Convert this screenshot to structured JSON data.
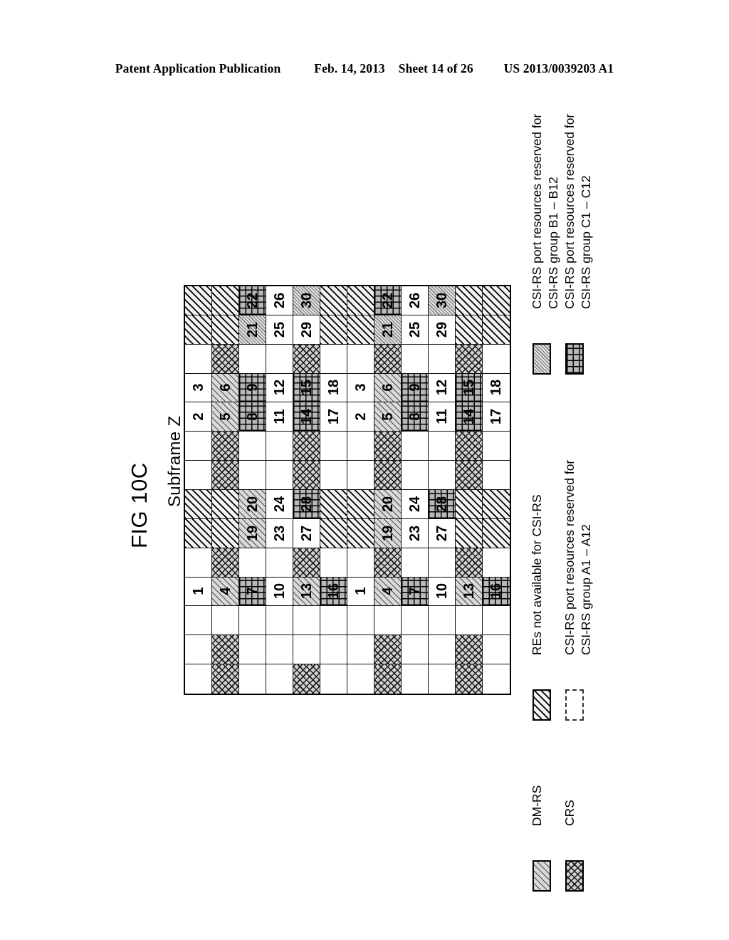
{
  "header": {
    "publication": "Patent Application Publication",
    "date": "Feb. 14, 2013",
    "sheet": "Sheet 14 of 26",
    "doc_number": "US 2013/0039203 A1"
  },
  "figure": {
    "title": "FIG 10C",
    "subtitle": "Subframe Z"
  },
  "legend": {
    "top_right": [
      {
        "swatch": "groupb-swatch",
        "line1": "CSI-RS port resources reserved for",
        "line2": "CSI-RS group B1 – B12"
      },
      {
        "swatch": "groupc-swatch",
        "line1": "CSI-RS port resources reserved for",
        "line2": "CSI-RS group C1 – C12"
      }
    ],
    "middle_right": [
      {
        "swatch": "na-swatch",
        "line1": "REs not available for CSI-RS",
        "line2": ""
      },
      {
        "swatch": "groupa-swatch",
        "line1": "CSI-RS port resources reserved for",
        "line2": "CSI-RS group A1 – A12"
      }
    ],
    "bottom_right": [
      {
        "swatch": "dmrs-swatch",
        "line1": "DM-RS",
        "line2": ""
      },
      {
        "swatch": "crs-swatch",
        "line1": "CRS",
        "line2": ""
      }
    ]
  },
  "grid": {
    "columns": 12,
    "rows": 14,
    "cell_types": {
      "white": "p-white",
      "na": "p-na",
      "dmrs": "p-dmrs",
      "crs": "p-crs",
      "groupb": "p-groupb",
      "groupc": "p-groupc"
    },
    "cells": [
      [
        {
          "t": "na"
        },
        {
          "t": "na"
        },
        {
          "t": "groupc",
          "n": "22"
        },
        {
          "t": "white",
          "n": "26"
        },
        {
          "t": "groupb",
          "n": "30"
        },
        {
          "t": "na"
        },
        {
          "t": "na"
        },
        {
          "t": "groupc",
          "n": "22"
        },
        {
          "t": "white",
          "n": "26"
        },
        {
          "t": "groupb",
          "n": "30"
        },
        {
          "t": "na"
        },
        {
          "t": "na"
        }
      ],
      [
        {
          "t": "na"
        },
        {
          "t": "na"
        },
        {
          "t": "groupb",
          "n": "21"
        },
        {
          "t": "white",
          "n": "25"
        },
        {
          "t": "white",
          "n": "29"
        },
        {
          "t": "na"
        },
        {
          "t": "na"
        },
        {
          "t": "groupb",
          "n": "21"
        },
        {
          "t": "white",
          "n": "25"
        },
        {
          "t": "white",
          "n": "29"
        },
        {
          "t": "na"
        },
        {
          "t": "na"
        }
      ],
      [
        {
          "t": "white"
        },
        {
          "t": "crs"
        },
        {
          "t": "white"
        },
        {
          "t": "white"
        },
        {
          "t": "crs"
        },
        {
          "t": "white"
        },
        {
          "t": "white"
        },
        {
          "t": "crs"
        },
        {
          "t": "white"
        },
        {
          "t": "white"
        },
        {
          "t": "crs"
        },
        {
          "t": "white"
        }
      ],
      [
        {
          "t": "white",
          "n": "3"
        },
        {
          "t": "dmrs",
          "n": "6"
        },
        {
          "t": "groupc",
          "n": "9"
        },
        {
          "t": "white",
          "n": "12"
        },
        {
          "t": "groupc",
          "n": "15"
        },
        {
          "t": "white",
          "n": "18"
        },
        {
          "t": "white",
          "n": "3"
        },
        {
          "t": "dmrs",
          "n": "6"
        },
        {
          "t": "groupc",
          "n": "9"
        },
        {
          "t": "white",
          "n": "12"
        },
        {
          "t": "groupc",
          "n": "15"
        },
        {
          "t": "white",
          "n": "18"
        }
      ],
      [
        {
          "t": "white",
          "n": "2"
        },
        {
          "t": "dmrs",
          "n": "5"
        },
        {
          "t": "groupc",
          "n": "8"
        },
        {
          "t": "white",
          "n": "11"
        },
        {
          "t": "groupc",
          "n": "14"
        },
        {
          "t": "white",
          "n": "17"
        },
        {
          "t": "white",
          "n": "2"
        },
        {
          "t": "dmrs",
          "n": "5"
        },
        {
          "t": "groupc",
          "n": "8"
        },
        {
          "t": "white",
          "n": "11"
        },
        {
          "t": "groupc",
          "n": "14"
        },
        {
          "t": "white",
          "n": "17"
        }
      ],
      [
        {
          "t": "white"
        },
        {
          "t": "crs"
        },
        {
          "t": "white"
        },
        {
          "t": "white"
        },
        {
          "t": "crs"
        },
        {
          "t": "white"
        },
        {
          "t": "white"
        },
        {
          "t": "crs"
        },
        {
          "t": "white"
        },
        {
          "t": "white"
        },
        {
          "t": "crs"
        },
        {
          "t": "white"
        }
      ],
      [
        {
          "t": "white"
        },
        {
          "t": "crs"
        },
        {
          "t": "white"
        },
        {
          "t": "white"
        },
        {
          "t": "crs"
        },
        {
          "t": "white"
        },
        {
          "t": "white"
        },
        {
          "t": "crs"
        },
        {
          "t": "white"
        },
        {
          "t": "white"
        },
        {
          "t": "crs"
        },
        {
          "t": "white"
        }
      ],
      [
        {
          "t": "na"
        },
        {
          "t": "na"
        },
        {
          "t": "dmrs",
          "n": "20"
        },
        {
          "t": "white",
          "n": "24"
        },
        {
          "t": "groupc",
          "n": "28"
        },
        {
          "t": "na"
        },
        {
          "t": "na"
        },
        {
          "t": "dmrs",
          "n": "20"
        },
        {
          "t": "white",
          "n": "24"
        },
        {
          "t": "groupc",
          "n": "28"
        },
        {
          "t": "na"
        },
        {
          "t": "na"
        }
      ],
      [
        {
          "t": "na"
        },
        {
          "t": "na"
        },
        {
          "t": "dmrs",
          "n": "19"
        },
        {
          "t": "white",
          "n": "23"
        },
        {
          "t": "white",
          "n": "27"
        },
        {
          "t": "na"
        },
        {
          "t": "na"
        },
        {
          "t": "dmrs",
          "n": "19"
        },
        {
          "t": "white",
          "n": "23"
        },
        {
          "t": "white",
          "n": "27"
        },
        {
          "t": "na"
        },
        {
          "t": "na"
        }
      ],
      [
        {
          "t": "white"
        },
        {
          "t": "crs"
        },
        {
          "t": "white"
        },
        {
          "t": "white"
        },
        {
          "t": "crs"
        },
        {
          "t": "white"
        },
        {
          "t": "white"
        },
        {
          "t": "crs"
        },
        {
          "t": "white"
        },
        {
          "t": "white"
        },
        {
          "t": "crs"
        },
        {
          "t": "white"
        }
      ],
      [
        {
          "t": "white",
          "n": "1"
        },
        {
          "t": "dmrs",
          "n": "4"
        },
        {
          "t": "groupc",
          "n": "7"
        },
        {
          "t": "white",
          "n": "10"
        },
        {
          "t": "dmrs",
          "n": "13"
        },
        {
          "t": "groupc",
          "n": "16"
        },
        {
          "t": "white",
          "n": "1"
        },
        {
          "t": "dmrs",
          "n": "4"
        },
        {
          "t": "groupc",
          "n": "7"
        },
        {
          "t": "white",
          "n": "10"
        },
        {
          "t": "dmrs",
          "n": "13"
        },
        {
          "t": "groupc",
          "n": "16"
        }
      ],
      [
        {
          "t": "white"
        },
        {
          "t": "white"
        },
        {
          "t": "white"
        },
        {
          "t": "white"
        },
        {
          "t": "white"
        },
        {
          "t": "white"
        },
        {
          "t": "white"
        },
        {
          "t": "white"
        },
        {
          "t": "white"
        },
        {
          "t": "white"
        },
        {
          "t": "white"
        },
        {
          "t": "white"
        }
      ],
      [
        {
          "t": "white"
        },
        {
          "t": "crs"
        },
        {
          "t": "white"
        },
        {
          "t": "white"
        },
        {
          "t": "white"
        },
        {
          "t": "white"
        },
        {
          "t": "white"
        },
        {
          "t": "crs"
        },
        {
          "t": "white"
        },
        {
          "t": "white"
        },
        {
          "t": "crs"
        },
        {
          "t": "white"
        }
      ],
      [
        {
          "t": "white"
        },
        {
          "t": "crs"
        },
        {
          "t": "white"
        },
        {
          "t": "white"
        },
        {
          "t": "crs"
        },
        {
          "t": "white"
        },
        {
          "t": "white"
        },
        {
          "t": "crs"
        },
        {
          "t": "white"
        },
        {
          "t": "white"
        },
        {
          "t": "crs"
        },
        {
          "t": "white"
        }
      ]
    ]
  }
}
